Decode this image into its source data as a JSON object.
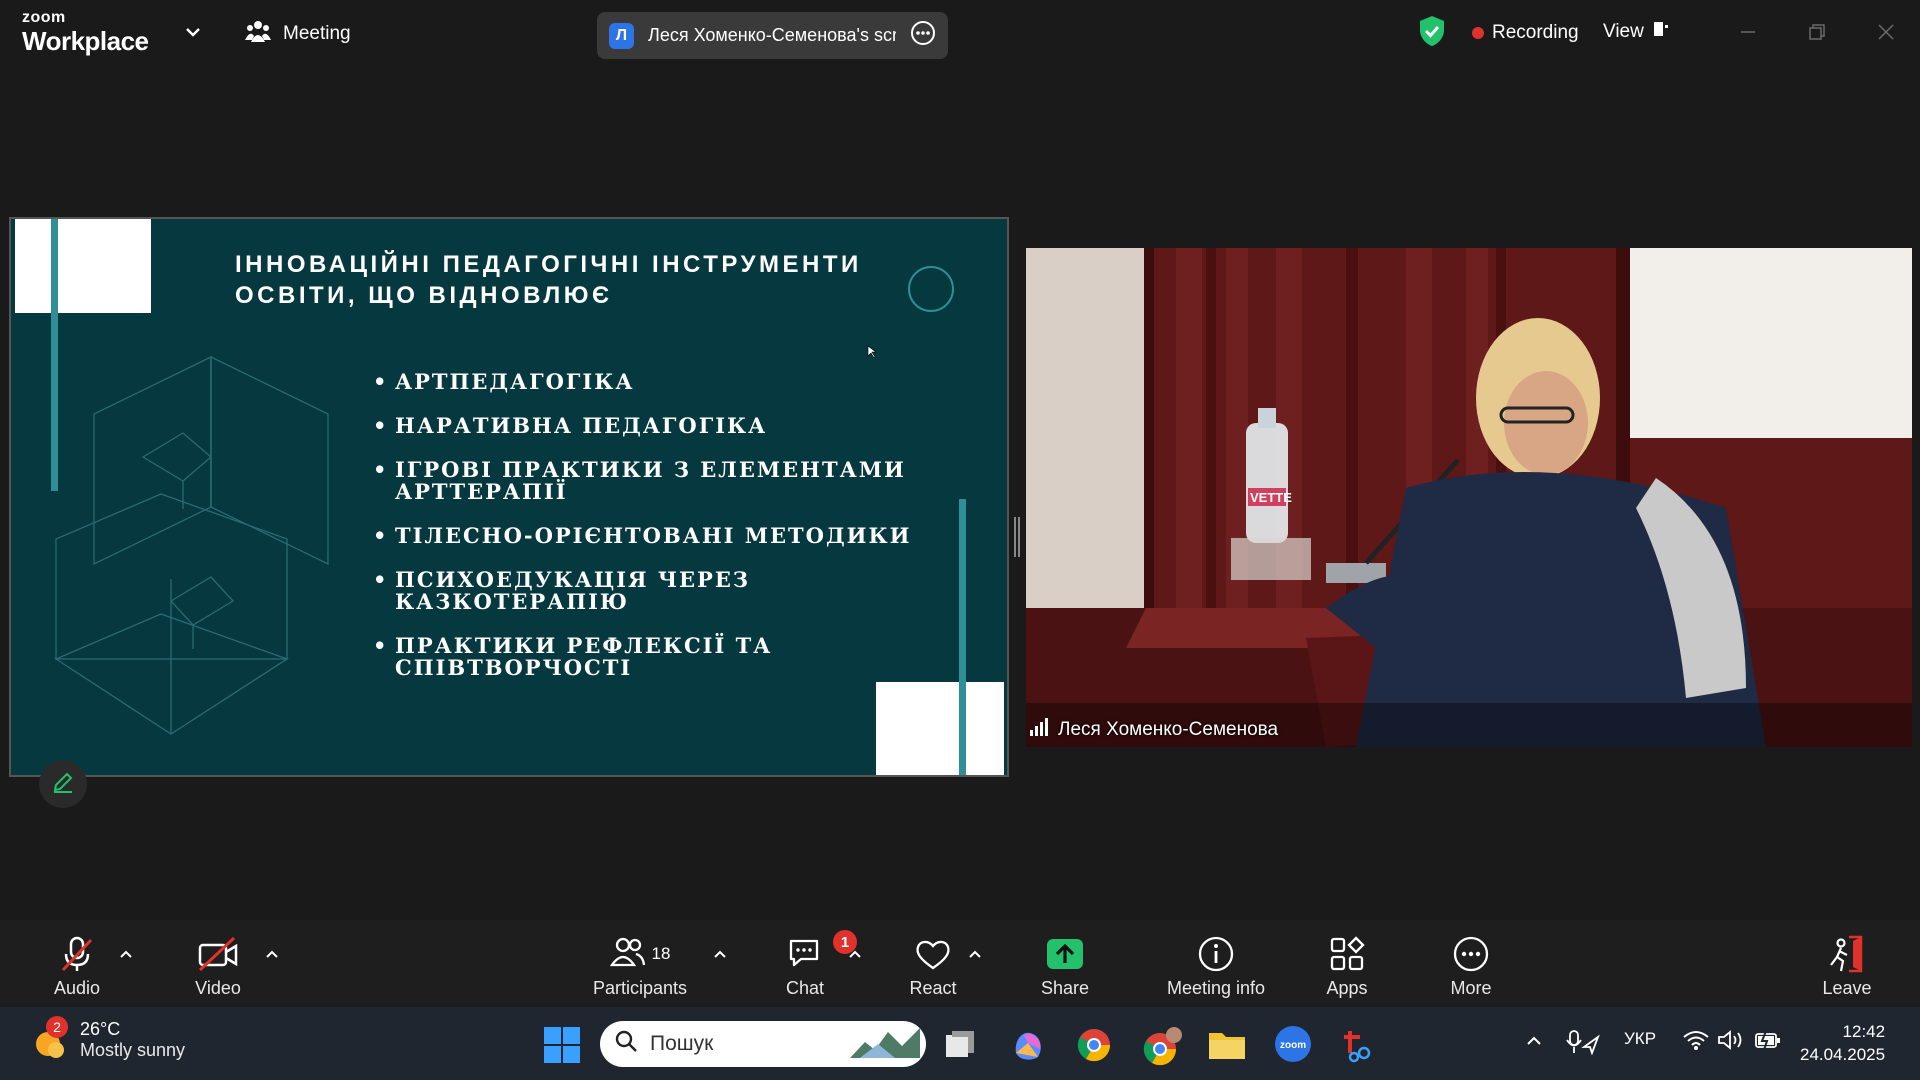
{
  "titlebar": {
    "logo_top": "zoom",
    "logo_bottom": "Workplace",
    "meeting_label": "Meeting",
    "share_badge": "Л",
    "share_title": "Леся Хоменко-Семенова's screen",
    "recording_label": "Recording",
    "view_label": "View"
  },
  "slide": {
    "title_line1": "ІННОВАЦІЙНІ ПЕДАГОГІЧНІ ІНСТРУМЕНТИ",
    "title_line2": "ОСВІТИ, ЩО ВІДНОВЛЮЄ",
    "items": [
      "АРТПЕДАГОГІКА",
      "НАРАТИВНА ПЕДАГОГІКА",
      "ІГРОВІ ПРАКТИКИ З ЕЛЕМЕНТАМИ АРТТЕРАПІЇ",
      "ТІЛЕСНО-ОРІЄНТОВАНІ МЕТОДИКИ",
      "ПСИХОЕДУКАЦІЯ ЧЕРЕЗ КАЗКОТЕРАПІЮ",
      "ПРАКТИКИ РЕФЛЕКСІЇ ТА СПІВТВОРЧОСТІ"
    ],
    "colors": {
      "background": "#06383f",
      "accent": "#2f8e96"
    }
  },
  "video": {
    "participant_name": "Леся Хоменко-Семенова",
    "bottle_label": "VETTE"
  },
  "toolbar": {
    "audio": "Audio",
    "video": "Video",
    "participants": "Participants",
    "participants_count": "18",
    "chat": "Chat",
    "chat_badge": "1",
    "react": "React",
    "share": "Share",
    "meeting_info": "Meeting info",
    "apps": "Apps",
    "more": "More",
    "leave": "Leave",
    "colors": {
      "share_green": "#23c16b",
      "muted_red": "#e0322c",
      "leave_red": "#e0322c"
    }
  },
  "taskbar": {
    "weather_badge": "2",
    "weather_temp": "26°C",
    "weather_desc": "Mostly sunny",
    "search_placeholder": "Пошук",
    "lang": "УКР",
    "time": "12:42",
    "date": "24.04.2025"
  }
}
